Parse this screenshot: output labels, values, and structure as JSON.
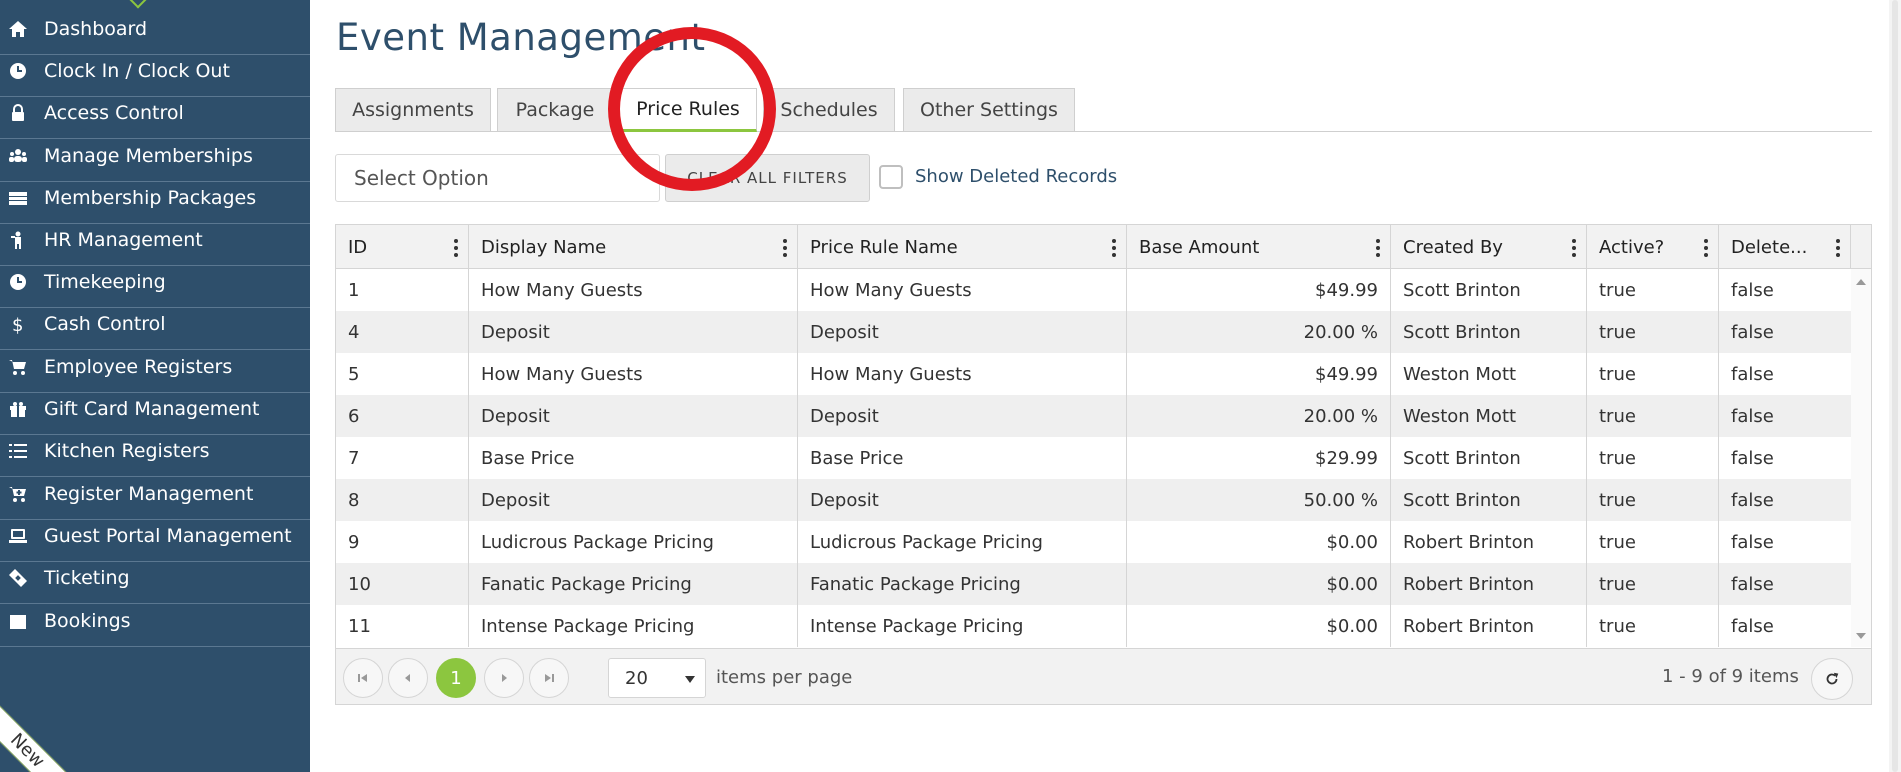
{
  "sidebar": {
    "items": [
      {
        "label": "Dashboard",
        "icon": "home-icon"
      },
      {
        "label": "Clock In / Clock Out",
        "icon": "clock-icon"
      },
      {
        "label": "Access Control",
        "icon": "lock-icon"
      },
      {
        "label": "Manage Memberships",
        "icon": "users-icon"
      },
      {
        "label": "Membership Packages",
        "icon": "card-icon"
      },
      {
        "label": "HR Management",
        "icon": "person-icon"
      },
      {
        "label": "Timekeeping",
        "icon": "clock-icon"
      },
      {
        "label": "Cash Control",
        "icon": "dollar-icon"
      },
      {
        "label": "Employee Registers",
        "icon": "cart-icon"
      },
      {
        "label": "Gift Card Management",
        "icon": "gift-icon"
      },
      {
        "label": "Kitchen Registers",
        "icon": "list-icon"
      },
      {
        "label": "Register Management",
        "icon": "cart-plus-icon"
      },
      {
        "label": "Guest Portal Management",
        "icon": "laptop-icon"
      },
      {
        "label": "Ticketing",
        "icon": "ticket-icon"
      },
      {
        "label": "Bookings",
        "icon": "calendar-icon"
      }
    ],
    "ribbon": "New"
  },
  "page": {
    "title": "Event Management"
  },
  "tabs": [
    {
      "label": "Assignments",
      "active": false
    },
    {
      "label": "Package",
      "active": false
    },
    {
      "label": "Price Rules",
      "active": true
    },
    {
      "label": "Schedules",
      "active": false
    },
    {
      "label": "Other Settings",
      "active": false
    }
  ],
  "filters": {
    "select_placeholder": "Select Option",
    "clear_label": "CLEAR ALL FILTERS",
    "show_deleted_label": "Show Deleted Records"
  },
  "grid": {
    "columns": [
      "ID",
      "Display Name",
      "Price Rule Name",
      "Base Amount",
      "Created By",
      "Active?",
      "Delete..."
    ],
    "rows": [
      [
        "1",
        "How Many Guests",
        "How Many Guests",
        "$49.99",
        "Scott Brinton",
        "true",
        "false"
      ],
      [
        "4",
        "Deposit",
        "Deposit",
        "20.00 %",
        "Scott Brinton",
        "true",
        "false"
      ],
      [
        "5",
        "How Many Guests",
        "How Many Guests",
        "$49.99",
        "Weston Mott",
        "true",
        "false"
      ],
      [
        "6",
        "Deposit",
        "Deposit",
        "20.00 %",
        "Weston Mott",
        "true",
        "false"
      ],
      [
        "7",
        "Base Price",
        "Base Price",
        "$29.99",
        "Scott Brinton",
        "true",
        "false"
      ],
      [
        "8",
        "Deposit",
        "Deposit",
        "50.00 %",
        "Scott Brinton",
        "true",
        "false"
      ],
      [
        "9",
        "Ludicrous Package Pricing",
        "Ludicrous Package Pricing",
        "$0.00",
        "Robert Brinton",
        "true",
        "false"
      ],
      [
        "10",
        "Fanatic Package Pricing",
        "Fanatic Package Pricing",
        "$0.00",
        "Robert Brinton",
        "true",
        "false"
      ],
      [
        "11",
        "Intense Package Pricing",
        "Intense Package Pricing",
        "$0.00",
        "Robert Brinton",
        "true",
        "false"
      ]
    ]
  },
  "pager": {
    "current_page": "1",
    "page_size": "20",
    "items_per_page_label": "items per page",
    "info": "1 - 9 of 9 items"
  },
  "colors": {
    "sidebar_bg": "#2e4f6b",
    "accent": "#8cc63f",
    "annotation": "#e21b23"
  }
}
